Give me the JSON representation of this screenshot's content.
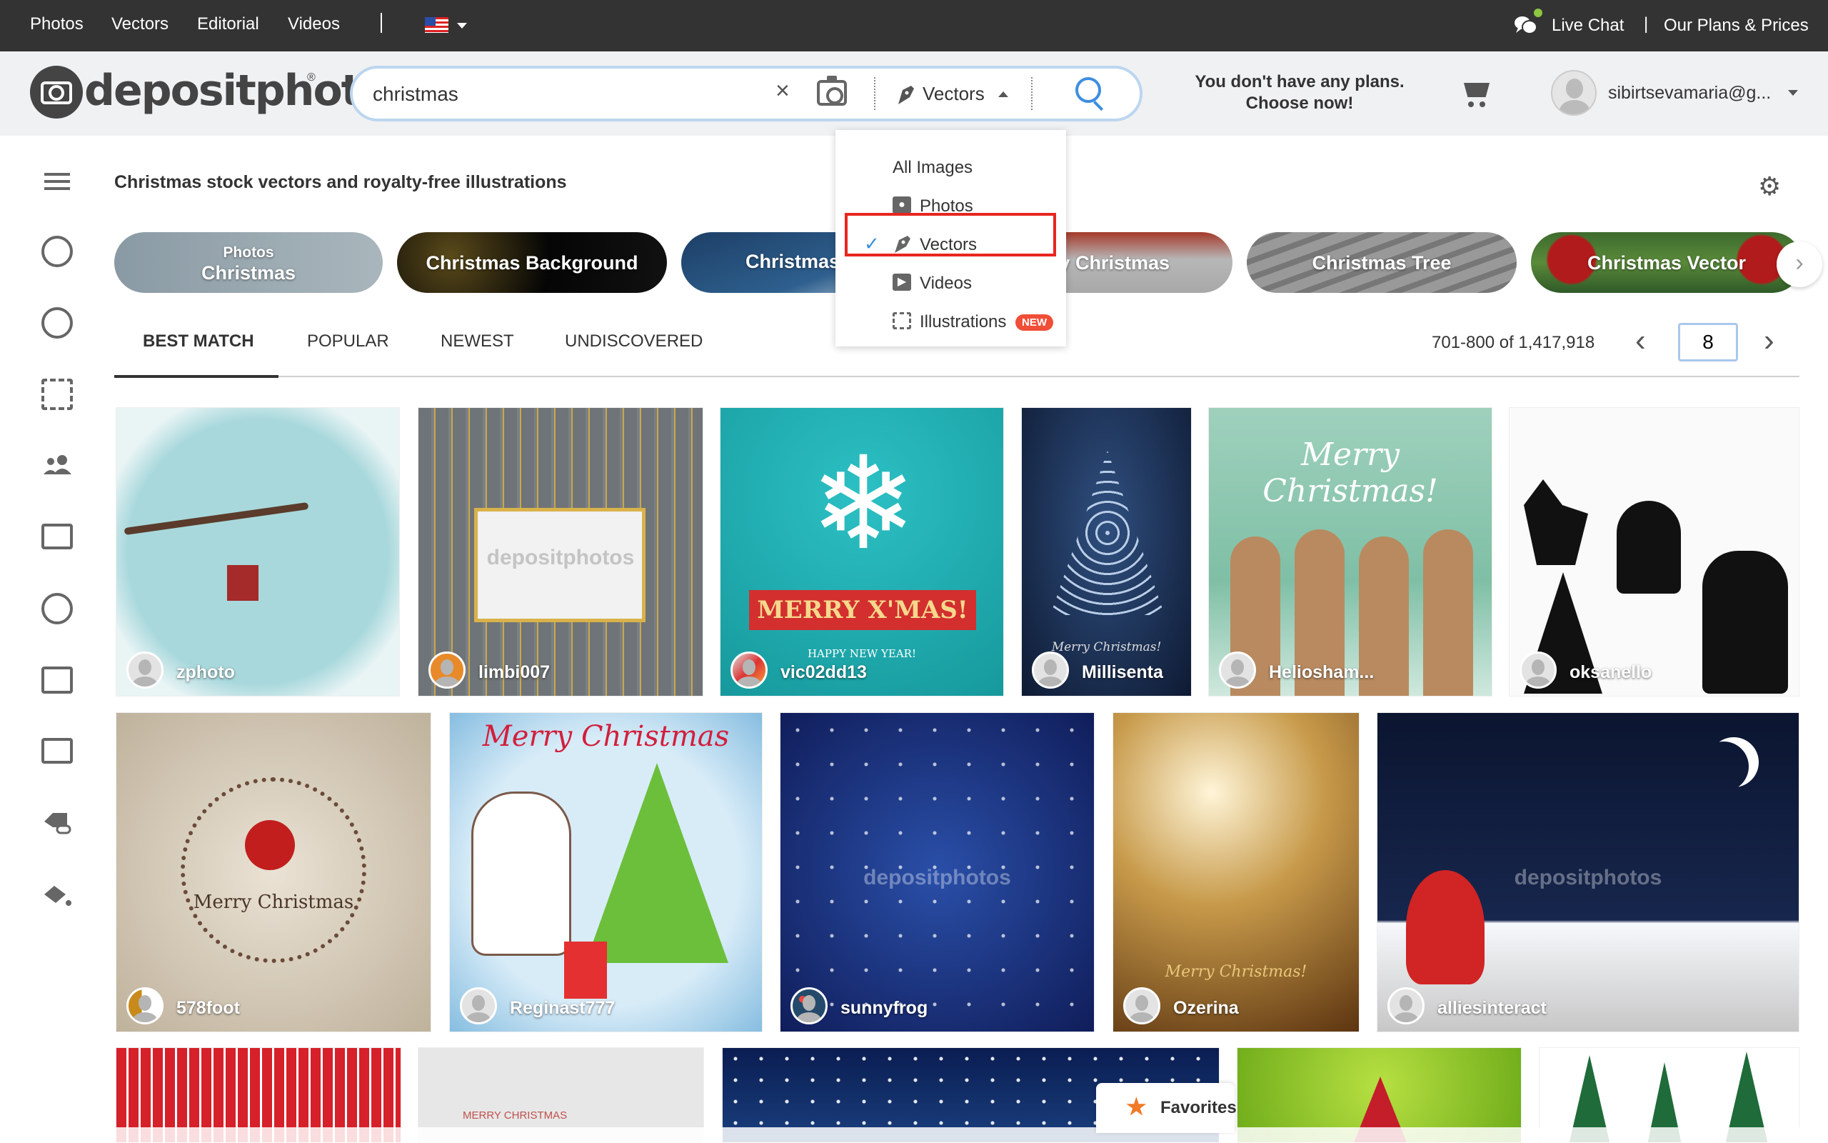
{
  "topbar": {
    "nav": [
      "Photos",
      "Vectors",
      "Editorial",
      "Videos"
    ],
    "language_flag": "us-flag-icon",
    "live_chat": "Live Chat",
    "separator": "|",
    "plans_link": "Our Plans & Prices",
    "status_dot_color": "#8dc63f"
  },
  "header": {
    "logo_text": "depositphotos",
    "logo_reg": "®",
    "search": {
      "value": "christmas",
      "placeholder": "",
      "clear_icon": "×",
      "type_selected": "Vectors"
    },
    "plans_notice_line1": "You don't have any plans.",
    "plans_notice_line2": "Choose now!",
    "user_email": "sibirtsevamaria@g..."
  },
  "type_menu": {
    "items": [
      {
        "label": "All Images",
        "icon": "",
        "selected": false
      },
      {
        "label": "Photos",
        "icon": "camera-icon",
        "selected": false
      },
      {
        "label": "Vectors",
        "icon": "pen-nib-icon",
        "selected": true
      },
      {
        "label": "Videos",
        "icon": "play-icon",
        "selected": false
      },
      {
        "label": "Illustrations",
        "icon": "illustration-icon",
        "selected": false,
        "badge": "NEW"
      }
    ],
    "check": "✓",
    "highlight_color": "#e8261f"
  },
  "page": {
    "title": "Christmas stock vectors and royalty-free illustrations"
  },
  "chips": [
    {
      "small": "Photos",
      "label": "Christmas"
    },
    {
      "label": "Christmas Background"
    },
    {
      "label": "Christmas"
    },
    {
      "label": "y Christmas"
    },
    {
      "label": "Christmas Tree"
    },
    {
      "label": "Christmas Vector"
    }
  ],
  "tabs": [
    "BEST MATCH",
    "POPULAR",
    "NEWEST",
    "UNDISCOVERED"
  ],
  "active_tab": "BEST MATCH",
  "pagination": {
    "results": "701-800 of 1,417,918",
    "page": "8",
    "prev": "‹",
    "next": "›"
  },
  "images_row1": [
    {
      "author": "zphoto",
      "art": ""
    },
    {
      "author": "limbi007",
      "art": "depositphotos"
    },
    {
      "author": "vic02dd13",
      "art": "MERRY X'MAS!",
      "art2": "HAPPY NEW YEAR!"
    },
    {
      "author": "Millisenta",
      "art": "Merry Christmas!"
    },
    {
      "author": "Heliosham...",
      "art": "Merry Christmas!"
    },
    {
      "author": "oksanello",
      "art": ""
    }
  ],
  "images_row2": [
    {
      "author": "578foot",
      "art": "Merry Christmas"
    },
    {
      "author": "Reginast777",
      "art": "Merry Christmas"
    },
    {
      "author": "sunnyfrog",
      "art": "depositphotos"
    },
    {
      "author": "Ozerina",
      "art": "Merry Christmas!"
    },
    {
      "author": "alliesinteract",
      "art": "depositphotos"
    }
  ],
  "images_row3": [
    {
      "art": ""
    },
    {
      "art": "MERRY CHRISTMAS"
    },
    {
      "art": ""
    },
    {
      "art": ""
    },
    {
      "art": ""
    }
  ],
  "favorites": {
    "label": "Favorites",
    "icon": "★"
  },
  "icons": {
    "gear": "⚙",
    "chip_next": "›",
    "star": "★"
  }
}
